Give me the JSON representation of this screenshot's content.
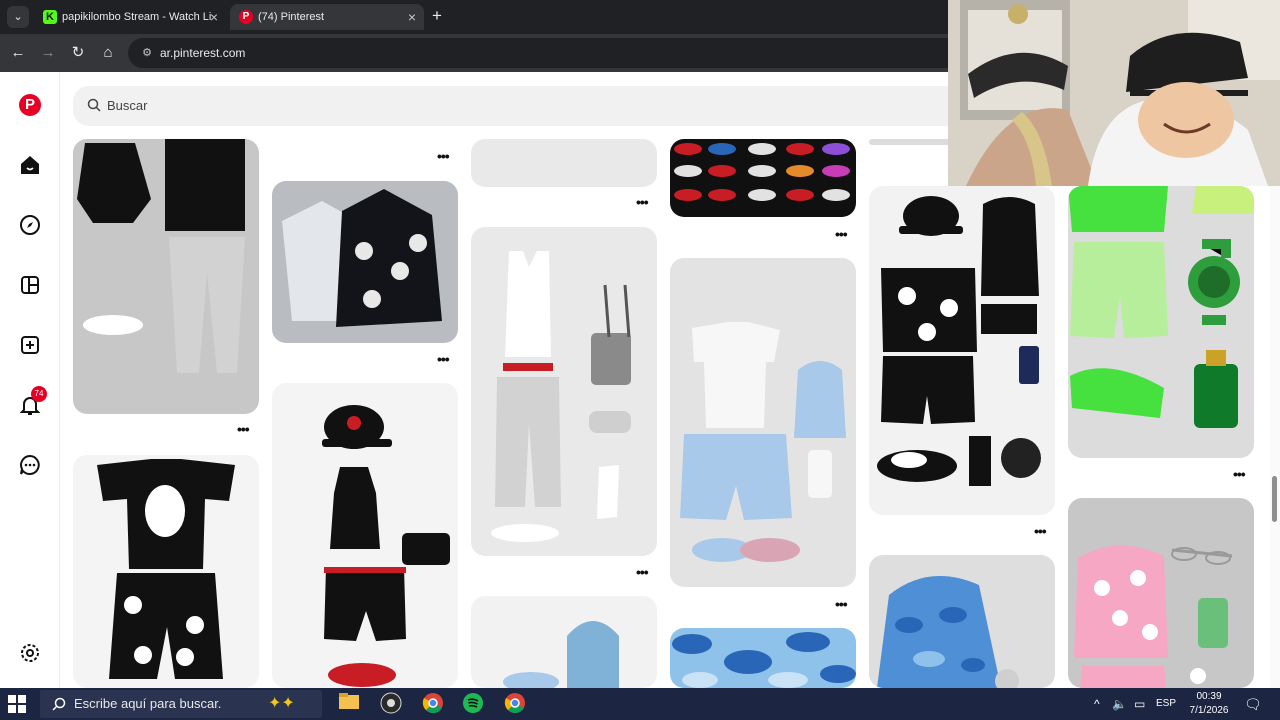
{
  "browser": {
    "tabs": [
      {
        "title": "papikilombo Stream - Watch Li",
        "icon": "kick-k-icon",
        "favicon_letter": "K"
      },
      {
        "title": "(74) Pinterest",
        "icon": "pinterest-icon",
        "favicon_letter": "P",
        "active": true
      }
    ],
    "url": "ar.pinterest.com"
  },
  "pinterest": {
    "search_placeholder": "Buscar",
    "notifications_count": "74",
    "sidebar_icons": [
      "pinterest-logo-icon",
      "home-icon",
      "explore-compass-icon",
      "boards-icon",
      "create-plus-icon",
      "notifications-bell-icon",
      "messages-icon",
      "settings-gear-icon"
    ],
    "pins": [
      {
        "name": "pin-black-hoodie-gray-joggers",
        "colors": [
          "#c3c3c3",
          "#111111"
        ]
      },
      {
        "name": "pin-denim-tears-hoodies",
        "colors": [
          "#b9bcc0",
          "#13141a"
        ]
      },
      {
        "name": "pin-bulls-outfit",
        "colors": [
          "#f4f4f4",
          "#c81d25"
        ]
      },
      {
        "name": "pin-tank-top-outfit",
        "colors": [
          "#e9e9e9",
          "#ffffff"
        ]
      },
      {
        "name": "pin-sneakers-grid",
        "colors": [
          "#101010",
          "#c81d25"
        ]
      },
      {
        "name": "pin-white-tee-blue-shorts",
        "colors": [
          "#e3e3e3",
          "#a9c9ea"
        ]
      },
      {
        "name": "pin-la-cap-black-outfit",
        "colors": [
          "#f2f2f2",
          "#111111"
        ]
      },
      {
        "name": "pin-green-outfit",
        "colors": [
          "#dcdcdc",
          "#46e03f"
        ]
      },
      {
        "name": "pin-pink-hoodie",
        "colors": [
          "#c7c7c7",
          "#f6a7c4"
        ]
      },
      {
        "name": "pin-bape-tee-shorts",
        "colors": [
          "#f4f4f4",
          "#111111"
        ]
      },
      {
        "name": "pin-blue-camo-hoodie",
        "colors": [
          "#dedede",
          "#4f8fd6"
        ]
      },
      {
        "name": "pin-blue-beanie",
        "colors": [
          "#f2f2f2",
          "#7fb2d6"
        ]
      },
      {
        "name": "pin-blue-camo-texture",
        "colors": [
          "#8ec2ea",
          "#2a66b7"
        ]
      }
    ]
  },
  "taskbar": {
    "search_placeholder": "Escribe aquí para buscar.",
    "language": "ESP",
    "time": "00:39",
    "date": "7/1/2026"
  }
}
